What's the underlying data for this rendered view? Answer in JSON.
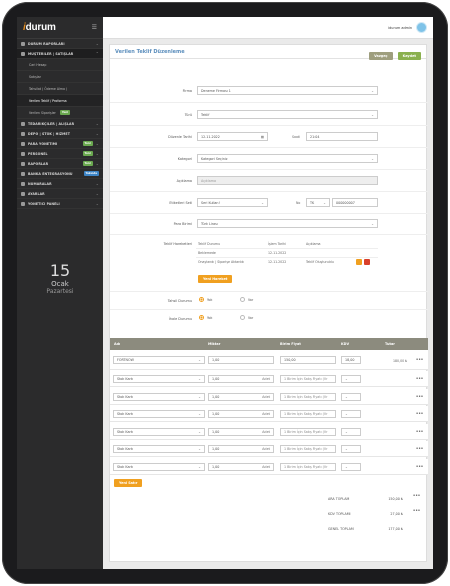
{
  "sidebar": {
    "brand_i": "i",
    "brand_rest": "durum",
    "items": [
      {
        "label": "DURUM RAPORLARI"
      },
      {
        "label": "MÜŞTERİLER | SATIŞLAR"
      },
      {
        "label": "TEDARİKÇİLER | ALIŞLAR"
      },
      {
        "label": "DEPO | STOK | HİZMET"
      },
      {
        "label": "PARA YÖNETİMİ",
        "badge": "Yeni"
      },
      {
        "label": "PERSONEL",
        "badge": "Yeni"
      },
      {
        "label": "RAPORLAR",
        "badge": "Yeni"
      },
      {
        "label": "BANKA ENTEGRASYONU",
        "badge": "Yakında"
      },
      {
        "label": "NUMARALAR"
      },
      {
        "label": "AYARLAR"
      },
      {
        "label": "YÖNETİCİ PANELİ"
      }
    ],
    "sub": [
      {
        "label": "Cari Hesap"
      },
      {
        "label": "Satışlar"
      },
      {
        "label": "Tahsilat ( Ödeme Alma )"
      },
      {
        "label": "Verilen Teklif / Proforma"
      },
      {
        "label": "Verilen Siparişler",
        "badge": "Yeni"
      }
    ],
    "calendar": {
      "day": "15",
      "month": "Ocak",
      "weekday": "Pazartesi"
    }
  },
  "topbar": {
    "user": "idurum admin"
  },
  "form": {
    "title": "Verilen Teklif Düzenleme",
    "btn_back": "Vazgeç",
    "btn_save": "Kaydet",
    "firma_label": "Firma",
    "firma_value": "Deneme Firması 1",
    "tur_label": "Türü",
    "tur_value": "Teklif",
    "tarih_label": "Düzenle Tarihi",
    "tarih_value": "12.11.2022",
    "saat_label": "Saati",
    "saat_value": "21:04",
    "kategori_label": "Kategori",
    "kategori_value": "Kategori Seçiniz",
    "aciklama_label": "Açıklama",
    "aciklama_placeholder": "Açıklama",
    "etiket_label": "Etiketleri Seti",
    "etiket_value": "Seri Kullan!",
    "no_label": "No",
    "no_prefix": "TK",
    "no_value": "000000007",
    "para_label": "Para Birimi",
    "para_value": "Türk Lirası",
    "hareket_label": "Teklif Hareketleri",
    "hareket_cols": [
      "Teklif Durumu",
      "İşlem Tarihi",
      "Açıklama"
    ],
    "hareket_rows": [
      {
        "durum": "Beklemede",
        "tarih": "12.11.2022",
        "aciklama": ""
      },
      {
        "durum": "Onaylandı | Siparişe Aktarıldı",
        "tarih": "12.11.2022",
        "aciklama": "Teklif Oluşturuldu"
      }
    ],
    "hareket_add": "Yeni Hareket",
    "tahsil_label": "Tahsil Durumu",
    "tahsil_opt1": "Yok",
    "tahsil_opt2": "Var",
    "ihale_label": "İhale Durumu",
    "ihale_opt1": "Yok",
    "ihale_opt2": "Var"
  },
  "table": {
    "cols": [
      "Adı",
      "Miktar",
      "Birim Fiyat",
      "KDV",
      "Tutar"
    ],
    "first": {
      "product": "FORTNOW",
      "qty": "1,00",
      "price": "150,00",
      "kdv": "18,00",
      "total": "180,00 ₺"
    },
    "rows": [
      {
        "product": "Stok Kartı",
        "qty": "1,00",
        "unit": "Adet",
        "note": "1 Birim İçin Satış Fiyatı (Vr"
      },
      {
        "product": "Stok Kartı",
        "qty": "1,00",
        "unit": "Adet",
        "note": "1 Birim İçin Satış Fiyatı (Vr"
      },
      {
        "product": "Stok Kartı",
        "qty": "1,00",
        "unit": "Adet",
        "note": "1 Birim İçin Satış Fiyatı (Vr"
      },
      {
        "product": "Stok Kartı",
        "qty": "1,00",
        "unit": "Adet",
        "note": "1 Birim İçin Satış Fiyatı (Vr"
      },
      {
        "product": "Stok Kartı",
        "qty": "1,00",
        "unit": "Adet",
        "note": "1 Birim İçin Satış Fiyatı (Vr"
      },
      {
        "product": "Stok Kartı",
        "qty": "1,00",
        "unit": "Adet",
        "note": "1 Birim İçin Satış Fiyatı (Vr"
      }
    ],
    "add_row": "Yeni Satır",
    "totals": [
      {
        "label": "ARA TOPLAM",
        "value": "150,00 ₺"
      },
      {
        "label": "KDV TOPLAMI",
        "value": "27,00 ₺"
      },
      {
        "label": "GENEL TOPLAM",
        "value": "177,00 ₺"
      }
    ]
  },
  "colors": {
    "accent": "#f0a020",
    "title": "#5d8fbd",
    "sidebar": "#2b2b2c",
    "table_head": "#8c8b7e"
  }
}
